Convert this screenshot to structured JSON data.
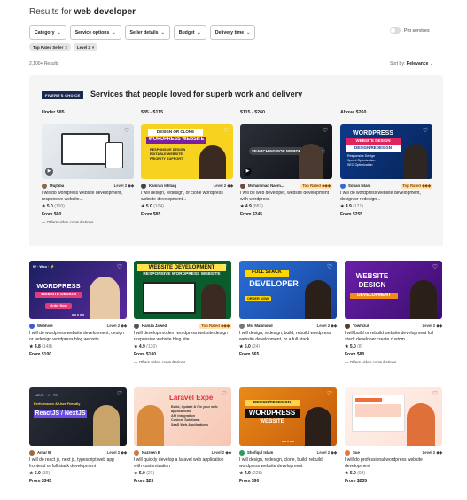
{
  "header": {
    "results_label": "Results for",
    "query": "web developer"
  },
  "filters": [
    "Category",
    "Service options",
    "Seller details",
    "Budget",
    "Delivery time"
  ],
  "pro_services": "Pro services",
  "active_tags": [
    "Top Rated Seller",
    "Level 2"
  ],
  "results_count": "2,100+ Results",
  "sort": {
    "label": "Sort by:",
    "value": "Relevance"
  },
  "promo": {
    "badge": "FIVERR'S CHOICE",
    "title": "Services that people loved for superb work and delivery",
    "price_bands": [
      "Under $85",
      "$85 - $115",
      "$115 - $260",
      "Above $260"
    ],
    "cards": [
      {
        "seller": "Mujtaba",
        "level": "Level 2 ◆◆",
        "desc": "I will do wordpress website development, responsive website...",
        "rating": "5.0",
        "count": "(100)",
        "price": "From $60",
        "consult": "Offers video consultations"
      },
      {
        "seller": "Kamran Ishtiaq",
        "level": "Level 2 ◆◆",
        "desc": "I will design, redesign, or clone wordpress website development...",
        "rating": "5.0",
        "count": "(104)",
        "price": "From $85",
        "banner": [
          "DESIGN OR CLONE",
          "WORDPRESS WEBSITE",
          "RESPONSIVE DESIGN",
          "EDITABLE WEBSITE",
          "PRIORITY SUPPORT"
        ]
      },
      {
        "seller": "Muhammad Naem...",
        "toprated": "Top Rated ◆◆◆",
        "desc": "I will be web developer, website development with wordpress",
        "rating": "4.9",
        "count": "(887)",
        "price": "From $245",
        "banner": [
          "SEARCH NG FOR",
          "WEBDEVELOPER?"
        ]
      },
      {
        "seller": "Sofian Islam",
        "toprated": "Top Rated ◆◆◆",
        "desc": "I will do wordpress website development, design or redesign...",
        "rating": "4.9",
        "count": "(171)",
        "price": "From $255",
        "banner": [
          "WORDPRESS",
          "WEBSITE DESIGN",
          "DESIGN/REDESIGN",
          "Responsive Design",
          "Speed Optimization",
          "SEO Optimization"
        ]
      }
    ]
  },
  "gigs_row1": [
    {
      "seller": "Webhive",
      "level": "Level 2 ◆◆",
      "desc": "I will do wordpress website development, design or redesign wordpress blog website",
      "rating": "4.8",
      "count": "(148)",
      "price": "From $100",
      "banner": [
        "WORDPRESS",
        "WEBSITE DESIGN",
        "Order Now"
      ]
    },
    {
      "seller": "Hamza Jawed",
      "toprated": "Top Rated ◆◆◆",
      "desc": "I will develop modern wordpress website design responsive website blog site",
      "rating": "4.9",
      "count": "(130)",
      "price": "From $100",
      "consult": "Offers video consultations",
      "banner": [
        "WEBSITE DEVELOPMENT",
        "RESPONSIVE WORDPRESS WEBSITE"
      ]
    },
    {
      "seller": "Ms. Mahmoud",
      "level": "Level 2 ◆◆",
      "desc": "I will design, redesign, build, rebuild wordpress website development, or a full stack...",
      "rating": "5.0",
      "count": "(24)",
      "price": "From $65",
      "banner": [
        "FULL STACK",
        "DEVELOPER",
        "ORDER NOW"
      ]
    },
    {
      "seller": "Towhizul",
      "level": "Level 2 ◆◆",
      "desc": "I will build or rebuild website development full stack developer create custom...",
      "rating": "5.0",
      "count": "(8)",
      "price": "From $80",
      "consult": "Offers video consultations",
      "banner": [
        "WEBSITE",
        "DESIGN",
        "DEVELOPMENT"
      ]
    }
  ],
  "gigs_row2": [
    {
      "seller": "Amar B",
      "level": "Level 2 ◆◆",
      "desc": "I will do react js, next js, typescript web app frontend or full stack development",
      "rating": "5.0",
      "count": "(39)",
      "price": "From $345",
      "banner": [
        "ReactJS / NextJS",
        "Performance & User Friendly"
      ]
    },
    {
      "seller": "Nazreen B",
      "level": "Level 2 ◆◆",
      "desc": "I will quickly develop a laravel web application with customization",
      "rating": "5.0",
      "count": "(21)",
      "price": "From $25",
      "banner": [
        "Laravel Expe",
        "Build, Update & Fix your web applications",
        "API Integration",
        "Custom Solutions",
        "SaaS Web Applications"
      ]
    },
    {
      "seller": "Shofiqul Islam",
      "level": "Level 2 ◆◆",
      "desc": "I will design, redesign, clone, build, rebuild wordpress website development",
      "rating": "4.9",
      "count": "(225)",
      "price": "From $90",
      "banner": [
        "DESIGN/REDESIGN",
        "WORDPRESS",
        "WEBSITE"
      ]
    },
    {
      "seller": "Sue",
      "level": "Level 2 ◆◆",
      "desc": "I will do professional wordpress website development",
      "rating": "5.0",
      "count": "(93)",
      "price": "From $235"
    }
  ]
}
